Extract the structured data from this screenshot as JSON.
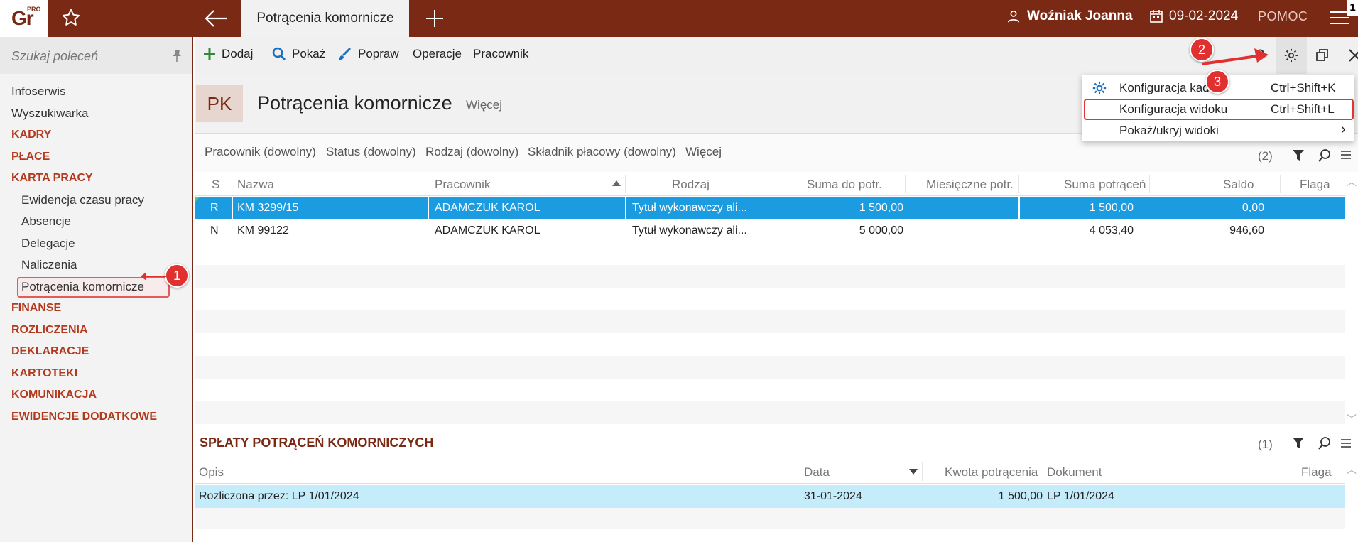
{
  "app": {
    "logo": "Gr",
    "logo_badge": "PRO",
    "tab_title": "Potrącenia komornicze",
    "user": "Woźniak Joanna",
    "date": "09-02-2024",
    "help": "POMOC",
    "corner_number": "1"
  },
  "sidebar": {
    "search_placeholder": "Szukaj poleceń",
    "items": [
      {
        "label": "Infoserwis",
        "type": "link"
      },
      {
        "label": "Wyszukiwarka",
        "type": "link"
      },
      {
        "label": "KADRY",
        "type": "section"
      },
      {
        "label": "PŁACE",
        "type": "section"
      },
      {
        "label": "KARTA PRACY",
        "type": "section"
      },
      {
        "label": "Ewidencja czasu pracy",
        "type": "sub"
      },
      {
        "label": "Absencje",
        "type": "sub"
      },
      {
        "label": "Delegacje",
        "type": "sub"
      },
      {
        "label": "Naliczenia",
        "type": "sub"
      },
      {
        "label": "Potrącenia komornicze",
        "type": "active"
      },
      {
        "label": "FINANSE",
        "type": "section"
      },
      {
        "label": "ROZLICZENIA",
        "type": "section"
      },
      {
        "label": "DEKLARACJE",
        "type": "section"
      },
      {
        "label": "KARTOTEKI",
        "type": "section"
      },
      {
        "label": "KOMUNIKACJA",
        "type": "section"
      },
      {
        "label": "EWIDENCJE DODATKOWE",
        "type": "section"
      }
    ]
  },
  "toolbar": {
    "add": "Dodaj",
    "show": "Pokaż",
    "edit": "Popraw",
    "operations": "Operacje",
    "employee": "Pracownik",
    "help_glyph": "?"
  },
  "header": {
    "badge": "PK",
    "title": "Potrącenia komornicze",
    "more": "Więcej"
  },
  "filters": {
    "items": [
      "Pracownik (dowolny)",
      "Status (dowolny)",
      "Rodzaj (dowolny)",
      "Składnik płacowy (dowolny)",
      "Więcej"
    ],
    "count": "(2)"
  },
  "grid": {
    "columns": [
      "S",
      "Nazwa",
      "Pracownik",
      "Rodzaj",
      "Suma do potr.",
      "Miesięczne potr.",
      "Suma potrąceń",
      "Saldo",
      "Flaga"
    ],
    "rows": [
      {
        "s": "R",
        "nazwa": "KM 3299/15",
        "pracownik": "ADAMCZUK KAROL",
        "rodzaj": "Tytuł wykonawczy ali...",
        "suma_do": "1 500,00",
        "miesieczne": "",
        "suma_potr": "1 500,00",
        "saldo": "0,00",
        "flaga": ""
      },
      {
        "s": "N",
        "nazwa": "KM 99122",
        "pracownik": "ADAMCZUK KAROL",
        "rodzaj": "Tytuł wykonawczy ali...",
        "suma_do": "5 000,00",
        "miesieczne": "",
        "suma_potr": "4 053,40",
        "saldo": "946,60",
        "flaga": ""
      }
    ]
  },
  "payments": {
    "title": "SPŁATY POTRĄCEŃ KOMORNICZYCH",
    "count": "(1)",
    "columns": [
      "Opis",
      "Data",
      "Kwota potrącenia",
      "Dokument",
      "Flaga"
    ],
    "rows": [
      {
        "opis": "Rozliczona przez: LP 1/01/2024",
        "data": "31-01-2024",
        "kwota": "1 500,00",
        "dokument": "LP 1/01/2024",
        "flaga": ""
      }
    ]
  },
  "menu": {
    "items": [
      {
        "label": "Konfiguracja kadr",
        "shortcut": "Ctrl+Shift+K"
      },
      {
        "label": "Konfiguracja widoku",
        "shortcut": "Ctrl+Shift+L"
      },
      {
        "label": "Pokaż/ukryj widoki",
        "shortcut": "›"
      }
    ]
  },
  "annotations": [
    "1",
    "2",
    "3"
  ],
  "colors": {
    "brand": "#7a2a14",
    "section": "#b3391d",
    "selection": "#1b9be0",
    "annotation": "#e03030"
  }
}
